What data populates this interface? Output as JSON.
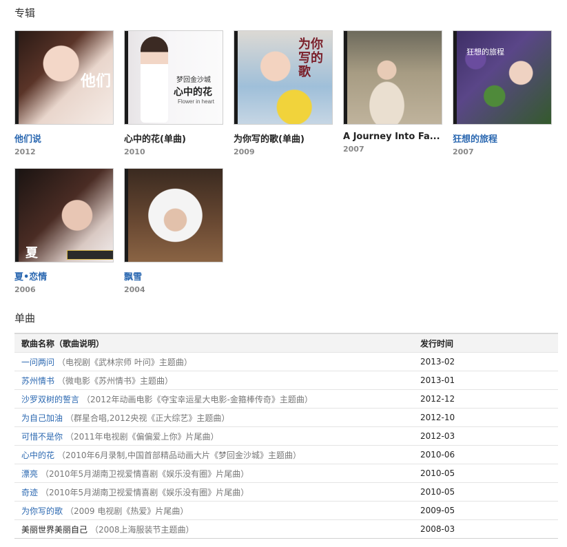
{
  "albums_heading": "专辑",
  "singles_heading": "单曲",
  "albums": [
    {
      "title": "他们说",
      "year": "2012",
      "cover_text": "他们"
    },
    {
      "title": "心中的花(单曲)",
      "year": "2010",
      "cover_text": "心中的花",
      "cover_subtext": "梦回金沙城",
      "cover_caption": "Flower in heart"
    },
    {
      "title": "为你写的歌(单曲)",
      "year": "2009",
      "cover_text": "为你写的歌"
    },
    {
      "title": "A Journey Into Fa...",
      "year": "2007"
    },
    {
      "title": "狂想的旅程",
      "year": "2007",
      "cover_text": "狂想的旅程"
    },
    {
      "title": "夏•恋情",
      "year": "2006",
      "cover_text": "夏"
    },
    {
      "title": "飘雪",
      "year": "2004"
    }
  ],
  "table": {
    "col_song": "歌曲名称（歌曲说明）",
    "col_date": "发行时间",
    "rows": [
      {
        "name": "一问两问",
        "note": "（电视剧《武林宗师 叶问》主题曲）",
        "date": "2013-02"
      },
      {
        "name": "苏州情书",
        "note": "（微电影《苏州情书》主题曲）",
        "date": "2013-01"
      },
      {
        "name": "沙罗双树的誓言",
        "note": "（2012年动画电影《夺宝幸运星大电影-金箍棒传奇》主题曲）",
        "date": "2012-12"
      },
      {
        "name": "为自己加油",
        "note": "（群星合唱,2012央视《正大综艺》主题曲）",
        "date": "2012-10"
      },
      {
        "name": "可惜不是你",
        "note": "（2011年电视剧《偏偏爱上你》片尾曲）",
        "date": "2012-03"
      },
      {
        "name": "心中的花",
        "note": "（2010年6月录制,中国首部精品动画大片《梦回金沙城》主题曲）",
        "date": "2010-06"
      },
      {
        "name": "漂亮",
        "note": "（2010年5月湖南卫视爱情喜剧《娱乐没有圈》片尾曲）",
        "date": "2010-05"
      },
      {
        "name": "奇迹",
        "note": "（2010年5月湖南卫视爱情喜剧《娱乐没有圈》片尾曲）",
        "date": "2010-05"
      },
      {
        "name": "为你写的歌",
        "note": "（2009 电视剧《热爱》片尾曲）",
        "date": "2009-05"
      },
      {
        "name": "美丽世界美丽自己",
        "note": "（2008上海服装节主题曲）",
        "date": "2008-03"
      }
    ]
  }
}
